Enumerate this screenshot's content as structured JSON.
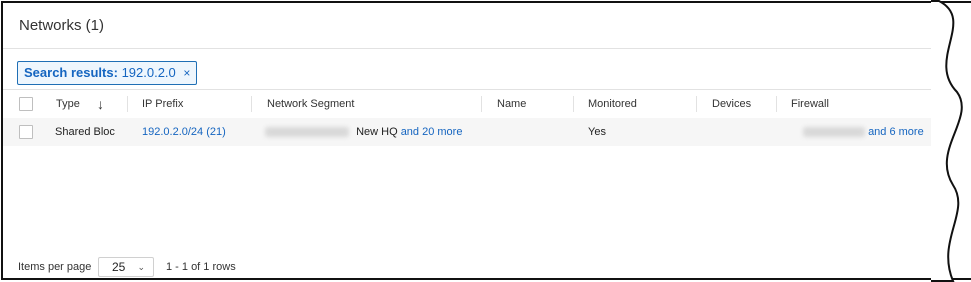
{
  "panel": {
    "title": "Networks (1)"
  },
  "filter_chip": {
    "label": "Search results:",
    "value": "192.0.2.0",
    "close_glyph": "×"
  },
  "table": {
    "columns": [
      "Type",
      "IP Prefix",
      "Network Segment",
      "Name",
      "Monitored",
      "Devices",
      "Firewall"
    ],
    "sort_icon": "↓",
    "rows": [
      {
        "type": "Shared Bloc",
        "ip_prefix": "192.0.2.0/24 (21)",
        "network_segment_text": "New HQ",
        "network_segment_more": "and 20 more",
        "name": "",
        "monitored": "Yes",
        "devices": "",
        "firewall_more": "and 6 more"
      }
    ]
  },
  "footer": {
    "items_per_page_label": "Items per page",
    "page_size": "25",
    "range": "1 - 1 of 1 rows"
  }
}
